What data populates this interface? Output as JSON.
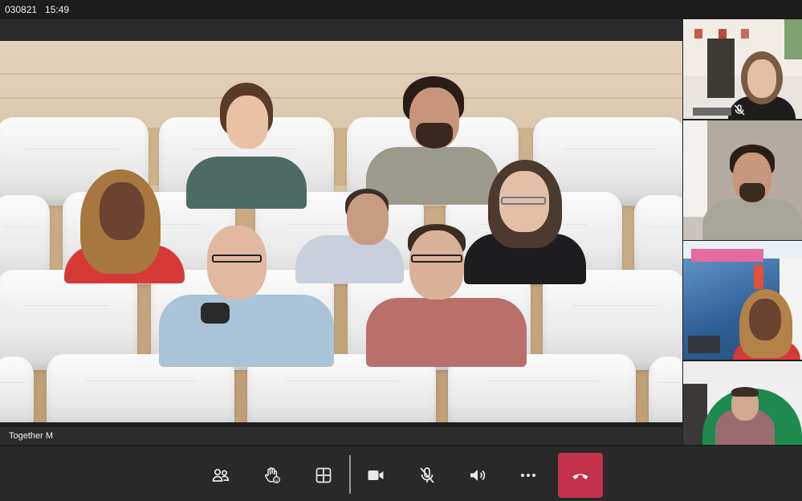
{
  "status_bar": {
    "code": "030821",
    "time": "15:49"
  },
  "stage": {
    "mode_label": "Together M"
  },
  "controls": {
    "people_icon": "people-icon",
    "reactions_icon": "raise-hand-icon",
    "view_icon": "grid-view-icon",
    "camera_icon": "video-camera-icon",
    "mic_icon": "microphone-muted-icon",
    "speaker_icon": "speaker-icon",
    "more_icon": "more-options-icon",
    "hangup_icon": "hang-up-icon",
    "hangup_color": "#c4314b"
  },
  "thumbnails": [
    {
      "id": "participant-1",
      "muted": true,
      "active": false
    },
    {
      "id": "participant-2",
      "muted": false,
      "active": false
    },
    {
      "id": "participant-3",
      "muted": false,
      "active": true
    },
    {
      "id": "participant-4",
      "muted": false,
      "active": false
    }
  ],
  "colors": {
    "background": "#1f1f1f",
    "toolbar": "#292929",
    "active_border": "#7b7fdc"
  }
}
